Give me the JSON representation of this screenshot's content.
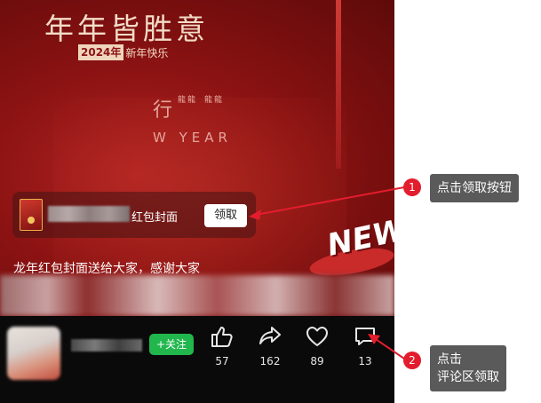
{
  "video": {
    "title": "年年皆胜意",
    "year_badge": "2024年",
    "year_badge_sub": "新年快乐",
    "seal_char": "行",
    "seal_chars": [
      "龍",
      "龍",
      "龍",
      "龍"
    ],
    "new_year_text": "W YEAR",
    "new_label": "NEW"
  },
  "packet": {
    "label": "红包封面",
    "claim_label": "领取"
  },
  "caption": "龙年红包封面送给大家，感谢大家",
  "bottom_bar": {
    "follow_label": "+关注",
    "actions": [
      {
        "icon": "like-icon",
        "count": "57"
      },
      {
        "icon": "share-icon",
        "count": "162"
      },
      {
        "icon": "favorite-icon",
        "count": "89"
      },
      {
        "icon": "comment-icon",
        "count": "13"
      }
    ]
  },
  "callouts": [
    {
      "number": "1",
      "text": "点击领取按钮"
    },
    {
      "number": "2",
      "line1": "点击",
      "line2": "评论区领取"
    }
  ],
  "colors": {
    "accent_red": "#e21d2d",
    "follow_green": "#21b74d",
    "callout_bg": "#5a5a5a"
  }
}
